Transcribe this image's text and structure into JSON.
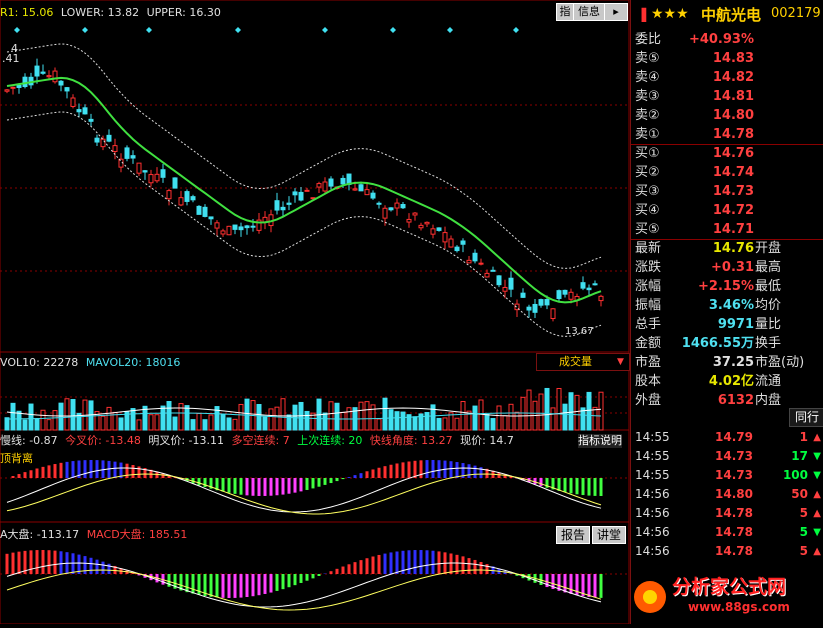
{
  "top_indicator": {
    "r1": "R1: 15.06",
    "lower": "LOWER: 13.82",
    "upper": "UPPER: 16.30"
  },
  "toolbar": {
    "zhi": "指",
    "info": "信息"
  },
  "stock": {
    "stars": "★★★",
    "name": "中航光电",
    "code": "002179"
  },
  "price_labels": {
    "left_41": ".41",
    "left_4": "4",
    "low_mark": "13.67"
  },
  "volume_panel": {
    "vol10": "VOL10: 22278",
    "mavol20": "MAVOL20: 18016",
    "selector": "成交量"
  },
  "macd_panel1": {
    "row": [
      "慢线: -0.87",
      "今叉价: -13.48",
      "明叉价: -13.11",
      "多空连续: 7",
      "上次连续: 20",
      "快线角度: 13.27",
      "现价: 14.7"
    ],
    "label": "顶背离",
    "help": "指标说明"
  },
  "macd_panel2": {
    "a": "A大盘: -113.17",
    "b": "MACD大盘: 185.51",
    "btn_report": "报告",
    "btn_lecture": "讲堂"
  },
  "order_book": {
    "ratio_label": "委比",
    "ratio_value": "+40.93%",
    "sells": [
      {
        "label": "卖⑤",
        "price": "14.83"
      },
      {
        "label": "卖④",
        "price": "14.82"
      },
      {
        "label": "卖③",
        "price": "14.81"
      },
      {
        "label": "卖②",
        "price": "14.80"
      },
      {
        "label": "卖①",
        "price": "14.78"
      }
    ],
    "buys": [
      {
        "label": "买①",
        "price": "14.76"
      },
      {
        "label": "买②",
        "price": "14.74"
      },
      {
        "label": "买③",
        "price": "14.73"
      },
      {
        "label": "买④",
        "price": "14.72"
      },
      {
        "label": "买⑤",
        "price": "14.71"
      }
    ]
  },
  "quote": [
    {
      "l1": "最新",
      "v": "14.76",
      "l2": "开盘",
      "c": "yel"
    },
    {
      "l1": "涨跌",
      "v": "+0.31",
      "l2": "最高",
      "c": "red"
    },
    {
      "l1": "涨幅",
      "v": "+2.15%",
      "l2": "最低",
      "c": "red"
    },
    {
      "l1": "振幅",
      "v": "3.46%",
      "l2": "均价",
      "c": "cyan"
    },
    {
      "l1": "总手",
      "v": "9971",
      "l2": "量比",
      "c": "cyan"
    },
    {
      "l1": "金额",
      "v": "1466.55万",
      "l2": "换手",
      "c": "cyan"
    },
    {
      "l1": "市盈",
      "v": "37.25",
      "l2": "市盈(动)",
      "c": "wht"
    },
    {
      "l1": "股本",
      "v": "4.02亿",
      "l2": "流通",
      "c": "yel"
    },
    {
      "l1": "外盘",
      "v": "6132",
      "l2": "内盘",
      "c": "red"
    }
  ],
  "peer_button": "同行",
  "ticks": [
    {
      "time": "14:55",
      "price": "14.79",
      "vol": "1",
      "dir": "up"
    },
    {
      "time": "14:55",
      "price": "14.73",
      "vol": "17",
      "dir": "down"
    },
    {
      "time": "14:55",
      "price": "14.73",
      "vol": "100",
      "dir": "down"
    },
    {
      "time": "14:56",
      "price": "14.80",
      "vol": "50",
      "dir": "up"
    },
    {
      "time": "14:56",
      "price": "14.78",
      "vol": "5",
      "dir": "up"
    },
    {
      "time": "14:56",
      "price": "14.78",
      "vol": "5",
      "dir": "down"
    },
    {
      "time": "14:56",
      "price": "14.78",
      "vol": "5",
      "dir": "up"
    }
  ],
  "watermark": {
    "name": "分析家公式网",
    "url": "www.88gs.com"
  },
  "colors": {
    "up": "#ff3030",
    "down": "#40e0f0",
    "ma": "#40e040",
    "grid": "#8a0000"
  }
}
